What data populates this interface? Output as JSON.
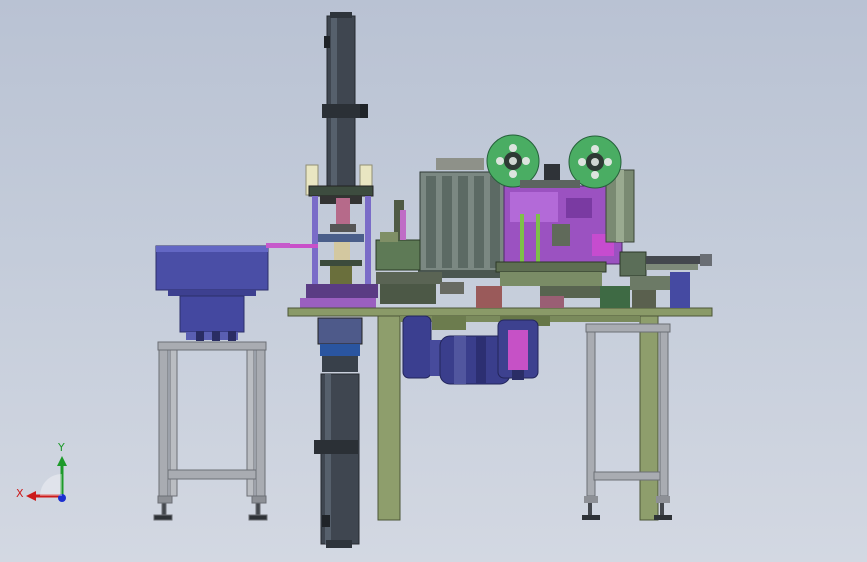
{
  "viewport": {
    "background_top": "#b9c2d3",
    "background_bottom": "#d3d8e2"
  },
  "triad": {
    "x_label": "X",
    "y_label": "Y",
    "x_color": "#cc1b1b",
    "y_color": "#1d9a2a",
    "z_color": "#1c2fd0"
  },
  "colors": {
    "frame_gray": "#a7aab0",
    "column_dark": "#3d444e",
    "bowl_blue": "#4c50a8",
    "table_green": "#8a9a6a",
    "motor_navy": "#3a3f8e",
    "reel_green": "#49ad63",
    "plate_purple": "#9a4fc0",
    "panel_gray": "#7d8a84",
    "magenta": "#cc44cc"
  }
}
